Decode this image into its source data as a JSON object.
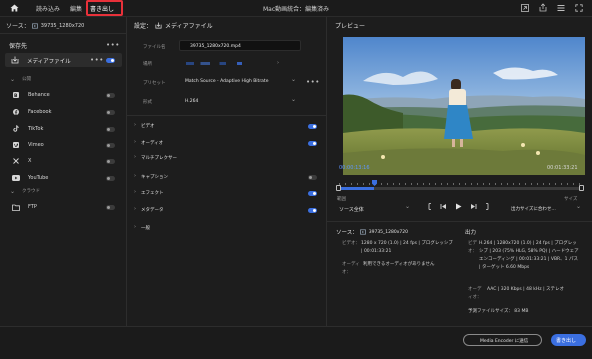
{
  "menu": {
    "home_icon": "home-icon",
    "tabs": [
      {
        "label": "読み込み"
      },
      {
        "label": "編集"
      },
      {
        "label": "書き出し",
        "active": true
      }
    ],
    "window_title": "Mac動画統合：編集済み"
  },
  "source": {
    "prefix": "ソース：",
    "clip_name": "39735_1280x720"
  },
  "left_panel": {
    "heading": "保存先",
    "media_file_label": "メディアファイル",
    "social_section": "公開",
    "destinations": [
      {
        "label": "Behance",
        "on": false
      },
      {
        "label": "Facebook",
        "on": false
      },
      {
        "label": "TikTok",
        "on": false
      },
      {
        "label": "Vimeo",
        "on": false
      },
      {
        "label": "X",
        "on": false
      },
      {
        "label": "YouTube",
        "on": false
      }
    ],
    "cloud_section": "クラウド",
    "ftp": {
      "label": "FTP",
      "on": false
    }
  },
  "settings": {
    "heading": "設定：",
    "heading_target": "メディアファイル",
    "file_name_label": "ファイル名",
    "file_name_value": "39735_1280x720.mp4",
    "location_label": "場所",
    "preset_label": "プリセット",
    "preset_value": "Match Source - Adaptive High Bitrate",
    "format_label": "形式",
    "format_value": "H.264",
    "sections": [
      {
        "label": "ビデオ",
        "on": true
      },
      {
        "label": "オーディオ",
        "on": true
      },
      {
        "label": "マルチプレクサー",
        "on": false
      },
      {
        "label": "キャプション",
        "on": false
      },
      {
        "label": "エフェクト",
        "on": true
      },
      {
        "label": "メタデータ",
        "on": true
      },
      {
        "label": "一般",
        "on": false
      }
    ]
  },
  "preview": {
    "heading": "プレビュー",
    "current_time": "00:00:13:16",
    "duration": "00:01:33:21",
    "range_label": "範囲",
    "range_value": "ソース全体",
    "size_label": "サイズ",
    "size_value": "出力サイズに合わせ…",
    "playhead_progress": 0.146
  },
  "summary": {
    "source_heading": "ソース：",
    "source_clip": "39735_1280x720",
    "source_video_key": "ビデオ：",
    "source_video_val": "1280 x 720 (1.0) | 24 fps | プログレッシブ | 00:01:33:21",
    "source_audio_key": "オーディオ：",
    "source_audio_val": "利用できるオーディオがありません",
    "output_heading": "出力",
    "output_video_key": "ビデオ：",
    "output_video_val": "H.264 | 1280x720 (1.0) | 24 fps | プログレッシブ | 203 (75% HLG, 58% PQ) | ハードウェアエンコーディング | 00:01:33:21 | VBR、1 パス | ターゲット 6.60 Mbps",
    "output_audio_key": "オーディオ：",
    "output_audio_val": "AAC | 320 Kbps | 48 kHz | ステレオ",
    "estimated_size": "予測ファイルサイズ： 83 MB"
  },
  "footer": {
    "media_encoder_button": "Media Encoder に送信",
    "export_button": "書き出し"
  },
  "colors": {
    "accent": "#3b6fe0",
    "highlight": "#e8313a",
    "bg": "#1d1d1d"
  }
}
